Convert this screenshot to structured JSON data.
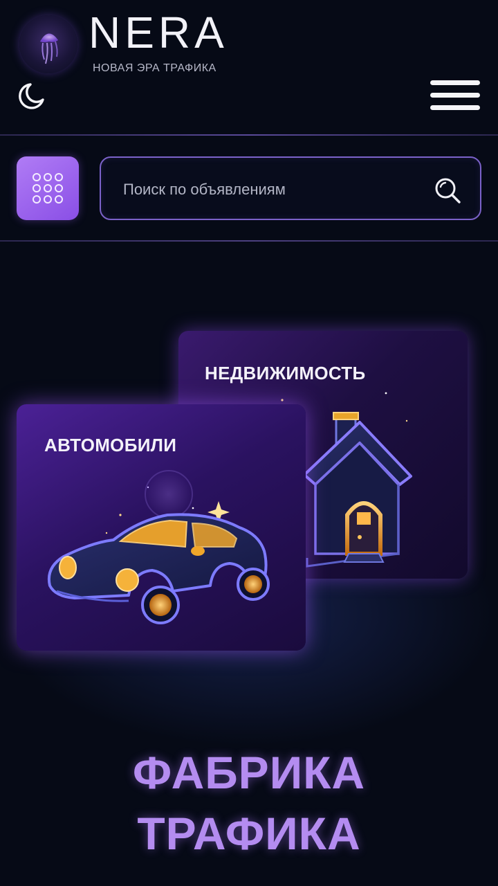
{
  "header": {
    "logo_text": "NERA",
    "tagline": "НОВАЯ ЭРА ТРАФИКА"
  },
  "search": {
    "placeholder": "Поиск по объявлениям",
    "value": ""
  },
  "categories": [
    {
      "label": "НЕДВИЖИМОСТЬ",
      "icon": "house-icon"
    },
    {
      "label": "АВТОМОБИЛИ",
      "icon": "car-icon"
    }
  ],
  "promo": {
    "line1": "ФАБРИКА",
    "line2": "ТРАФИКА"
  },
  "colors": {
    "background": "#060a16",
    "accent": "#9b63f0",
    "title": "#b48cf0",
    "gold": "#f0a62a"
  },
  "icons": {
    "logo": "jellyfish-logo-icon",
    "theme": "moon-icon",
    "menu": "hamburger-menu-icon",
    "catalog": "grid-dots-icon",
    "search": "search-icon"
  }
}
